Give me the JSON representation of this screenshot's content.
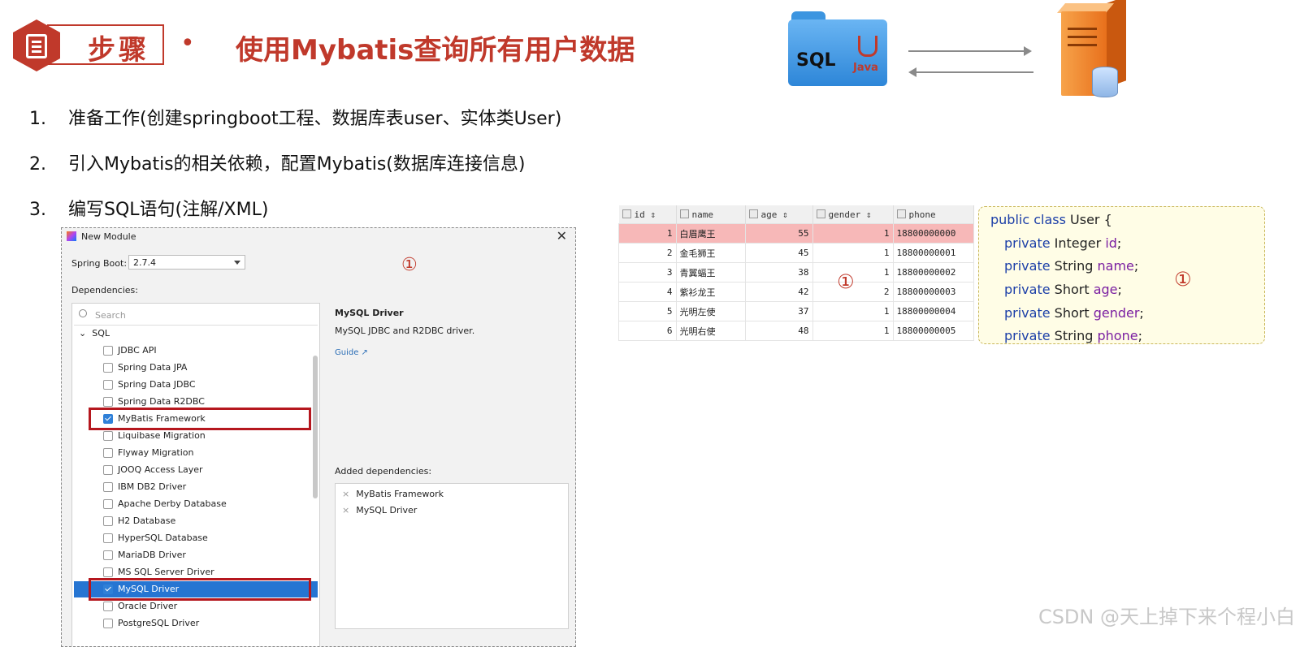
{
  "header": {
    "badge": "步骤",
    "bullet": "•",
    "title": "使用Mybatis查询所有用户数据",
    "folder_sql": "SQL",
    "folder_java": "Java"
  },
  "steps": [
    {
      "num": "1.",
      "text": "准备工作(创建springboot工程、数据库表user、实体类User)"
    },
    {
      "num": "2.",
      "text": "引入Mybatis的相关依赖，配置Mybatis(数据库连接信息)"
    },
    {
      "num": "3.",
      "text": "编写SQL语句(注解/XML)"
    }
  ],
  "dialog": {
    "title": "New Module",
    "close": "✕",
    "spring_boot_label": "Spring Boot:",
    "spring_boot_value": "2.7.4",
    "marker": "①",
    "dependencies_label": "Dependencies:",
    "search_placeholder": "Search",
    "group": "SQL",
    "items": [
      {
        "name": "JDBC API",
        "checked": false
      },
      {
        "name": "Spring Data JPA",
        "checked": false
      },
      {
        "name": "Spring Data JDBC",
        "checked": false
      },
      {
        "name": "Spring Data R2DBC",
        "checked": false
      },
      {
        "name": "MyBatis Framework",
        "checked": true
      },
      {
        "name": "Liquibase Migration",
        "checked": false
      },
      {
        "name": "Flyway Migration",
        "checked": false
      },
      {
        "name": "JOOQ Access Layer",
        "checked": false
      },
      {
        "name": "IBM DB2 Driver",
        "checked": false
      },
      {
        "name": "Apache Derby Database",
        "checked": false
      },
      {
        "name": "H2 Database",
        "checked": false
      },
      {
        "name": "HyperSQL Database",
        "checked": false
      },
      {
        "name": "MariaDB Driver",
        "checked": false
      },
      {
        "name": "MS SQL Server Driver",
        "checked": false
      },
      {
        "name": "MySQL Driver",
        "checked": true
      },
      {
        "name": "Oracle Driver",
        "checked": false
      },
      {
        "name": "PostgreSQL Driver",
        "checked": false
      }
    ],
    "detail_name": "MySQL Driver",
    "detail_desc": "MySQL JDBC and R2DBC driver.",
    "detail_link": "Guide ↗",
    "added_label": "Added dependencies:",
    "added": [
      "MyBatis Framework",
      "MySQL Driver"
    ]
  },
  "db_table": {
    "columns": [
      "id",
      "name",
      "age",
      "gender",
      "phone"
    ],
    "rows": [
      [
        "1",
        "白眉鹰王",
        "55",
        "1",
        "18800000000"
      ],
      [
        "2",
        "金毛狮王",
        "45",
        "1",
        "18800000001"
      ],
      [
        "3",
        "青翼蝠王",
        "38",
        "1",
        "18800000002"
      ],
      [
        "4",
        "紫衫龙王",
        "42",
        "2",
        "18800000003"
      ],
      [
        "5",
        "光明左使",
        "37",
        "1",
        "18800000004"
      ],
      [
        "6",
        "光明右使",
        "48",
        "1",
        "18800000005"
      ]
    ],
    "marker": "①"
  },
  "code": {
    "class_kw": "public class",
    "class_name": " User {",
    "fields": [
      {
        "kw": "private",
        "type": " Integer ",
        "name": "id",
        "end": ";"
      },
      {
        "kw": "private",
        "type": " String ",
        "name": "name",
        "end": ";"
      },
      {
        "kw": "private",
        "type": " Short ",
        "name": "age",
        "end": ";"
      },
      {
        "kw": "private",
        "type": " Short ",
        "name": "gender",
        "end": ";"
      },
      {
        "kw": "private",
        "type": " String ",
        "name": "phone",
        "end": ";"
      }
    ],
    "marker": "①"
  },
  "watermark": "CSDN @天上掉下来个程小白",
  "colors": {
    "accent": "#c0392b",
    "selection": "#2675d2",
    "highlight_row": "#f7b8b8"
  }
}
